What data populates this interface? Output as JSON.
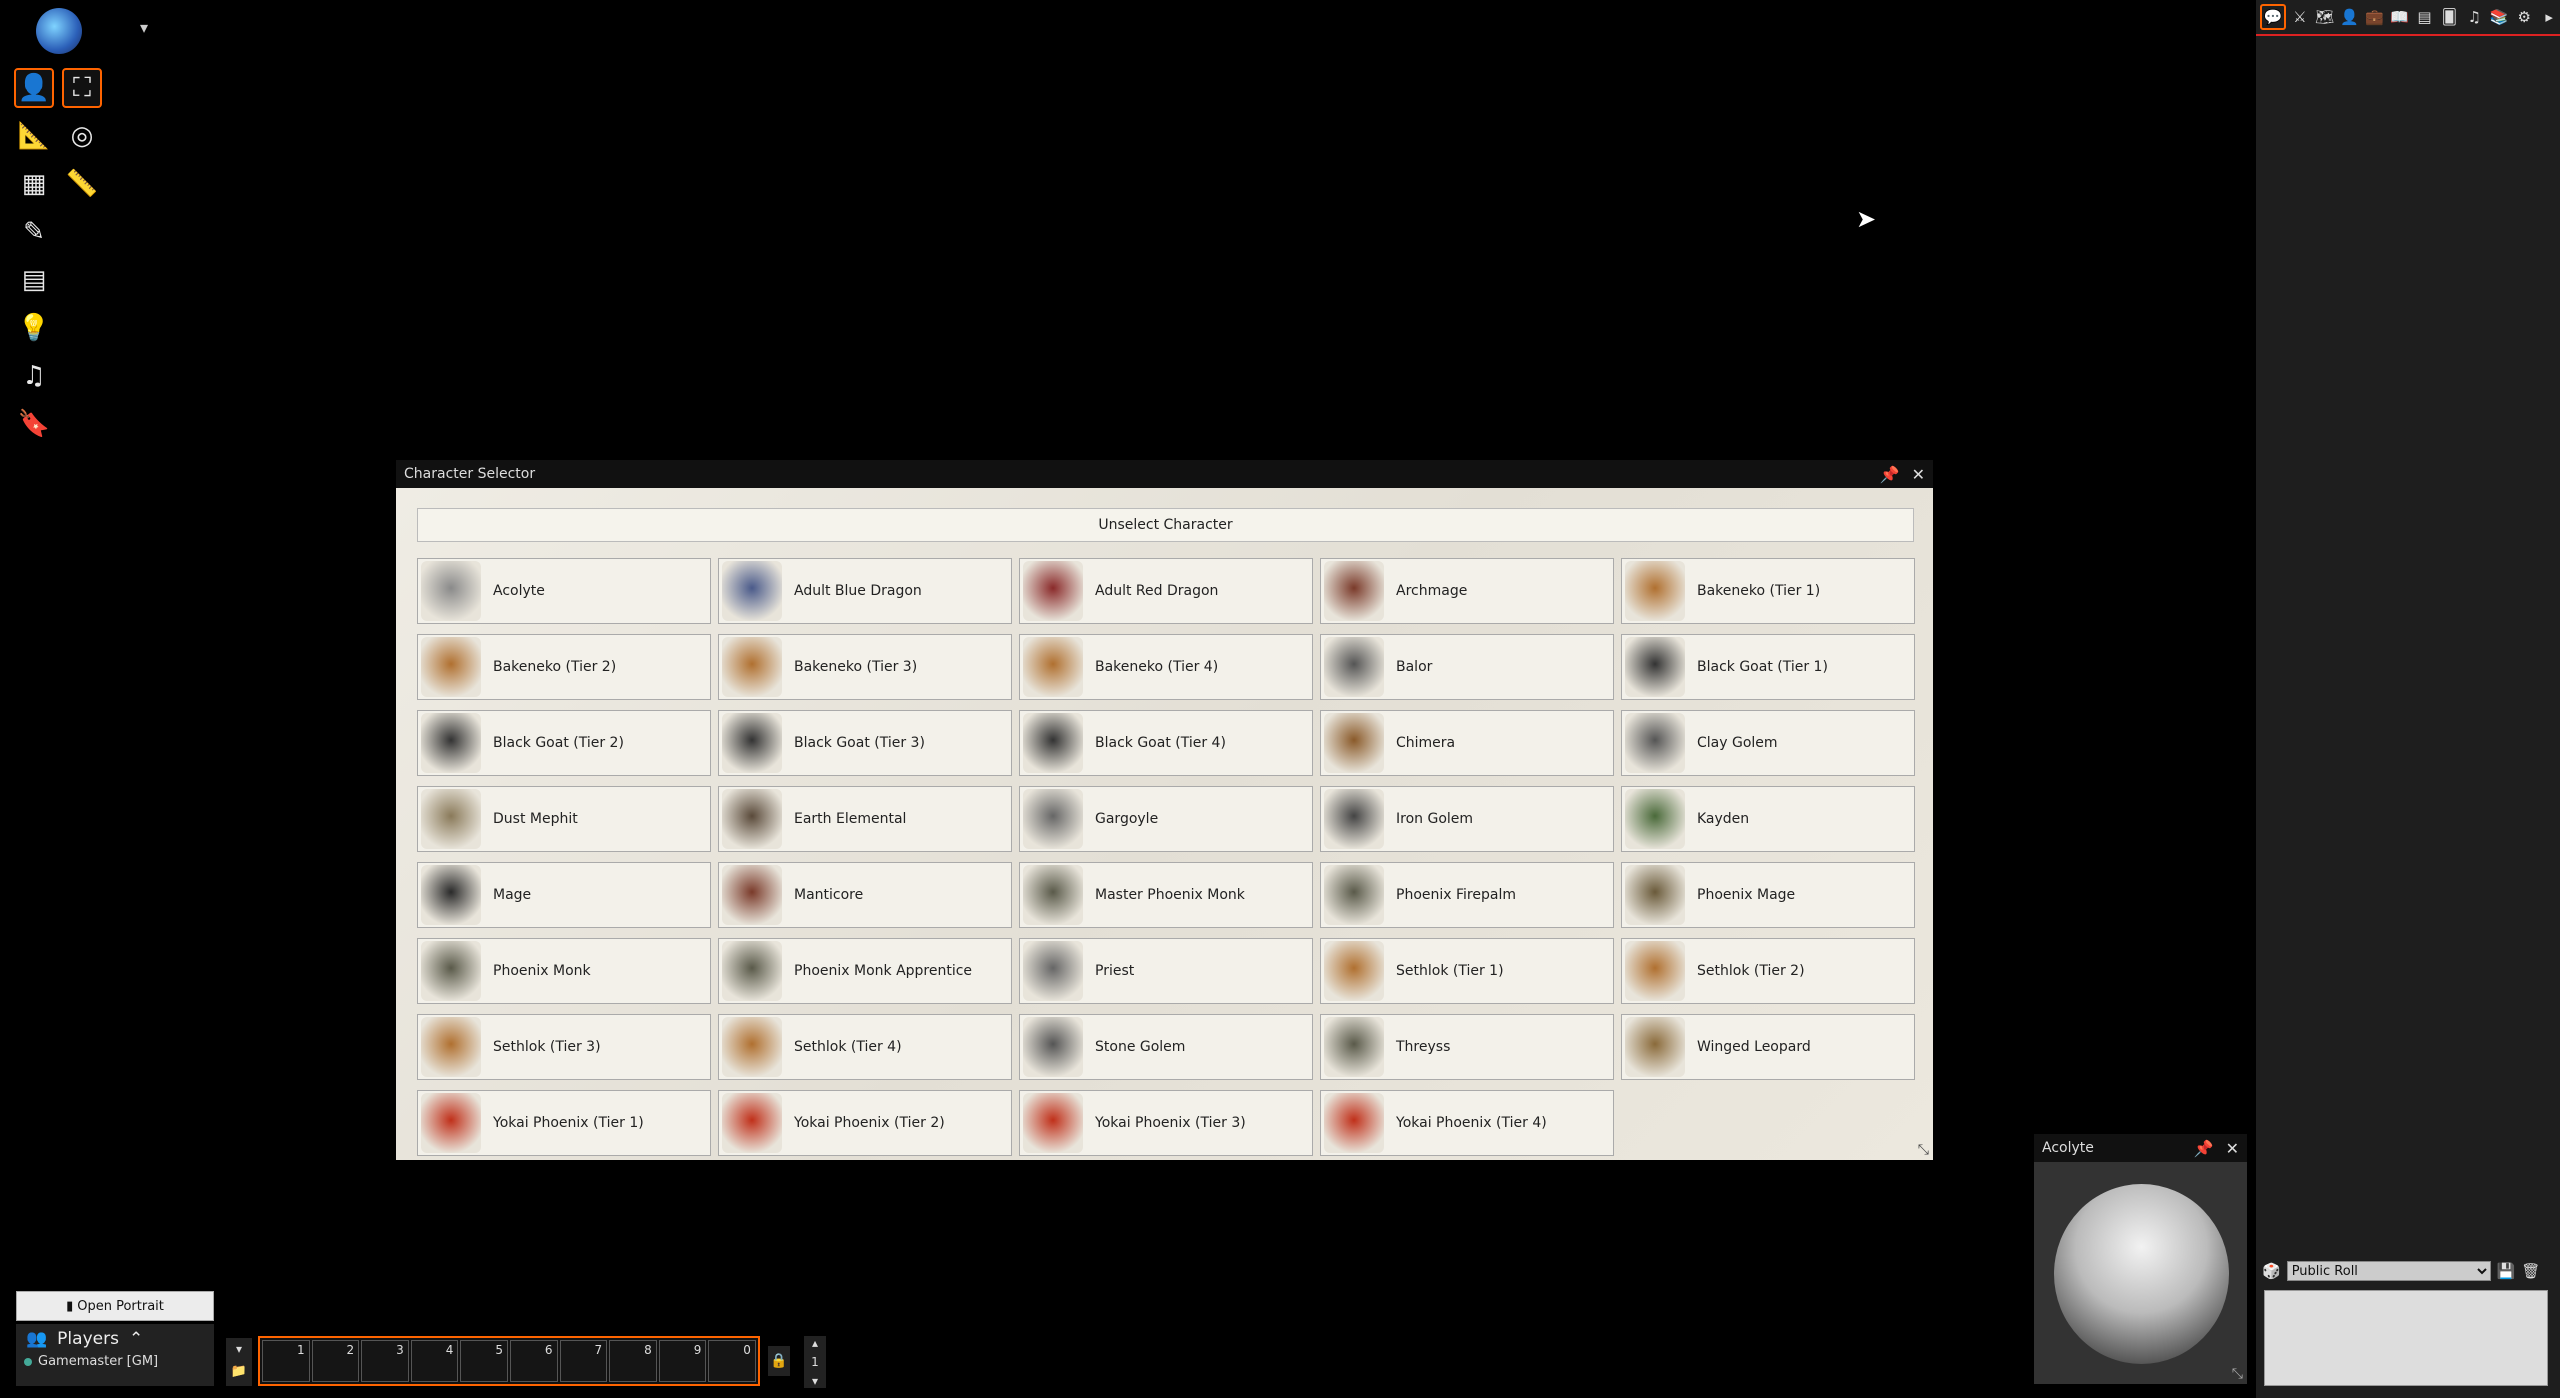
{
  "toolbar": {
    "logo_caret": "▾",
    "icons": [
      "token-controls-icon",
      "fullscreen-icon",
      "measure-icon",
      "target-icon",
      "tiles-icon",
      "ruler-icon",
      "drawing-icon",
      "walls-icon",
      "lighting-icon",
      "sounds-icon",
      "notes-icon"
    ]
  },
  "character_selector": {
    "title": "Character Selector",
    "unselect_label": "Unselect Character",
    "characters": [
      {
        "name": "Acolyte",
        "color": "#8a8a8a"
      },
      {
        "name": "Adult Blue Dragon",
        "color": "#4a5a8a"
      },
      {
        "name": "Adult Red Dragon",
        "color": "#8a2a2a"
      },
      {
        "name": "Archmage",
        "color": "#7a3a2a"
      },
      {
        "name": "Bakeneko (Tier 1)",
        "color": "#b07030"
      },
      {
        "name": "Bakeneko (Tier 2)",
        "color": "#b07030"
      },
      {
        "name": "Bakeneko (Tier 3)",
        "color": "#b07030"
      },
      {
        "name": "Bakeneko (Tier 4)",
        "color": "#b07030"
      },
      {
        "name": "Balor",
        "color": "#555555"
      },
      {
        "name": "Black Goat (Tier 1)",
        "color": "#333333"
      },
      {
        "name": "Black Goat (Tier 2)",
        "color": "#333333"
      },
      {
        "name": "Black Goat (Tier 3)",
        "color": "#333333"
      },
      {
        "name": "Black Goat (Tier 4)",
        "color": "#333333"
      },
      {
        "name": "Chimera",
        "color": "#8a5a2a"
      },
      {
        "name": "Clay Golem",
        "color": "#555555"
      },
      {
        "name": "Dust Mephit",
        "color": "#8a7a5a"
      },
      {
        "name": "Earth Elemental",
        "color": "#5a4a3a"
      },
      {
        "name": "Gargoyle",
        "color": "#666666"
      },
      {
        "name": "Iron Golem",
        "color": "#444444"
      },
      {
        "name": "Kayden",
        "color": "#4a6a3a"
      },
      {
        "name": "Mage",
        "color": "#2a2a2a"
      },
      {
        "name": "Manticore",
        "color": "#7a3a2a"
      },
      {
        "name": "Master Phoenix Monk",
        "color": "#5a5a4a"
      },
      {
        "name": "Phoenix Firepalm",
        "color": "#5a5a4a"
      },
      {
        "name": "Phoenix Mage",
        "color": "#6a5a3a"
      },
      {
        "name": "Phoenix Monk",
        "color": "#5a5a4a"
      },
      {
        "name": "Phoenix Monk Apprentice",
        "color": "#5a5a4a"
      },
      {
        "name": "Priest",
        "color": "#666666"
      },
      {
        "name": "Sethlok (Tier 1)",
        "color": "#b07030"
      },
      {
        "name": "Sethlok (Tier 2)",
        "color": "#b07030"
      },
      {
        "name": "Sethlok (Tier 3)",
        "color": "#b07030"
      },
      {
        "name": "Sethlok (Tier 4)",
        "color": "#b07030"
      },
      {
        "name": "Stone Golem",
        "color": "#555555"
      },
      {
        "name": "Threyss",
        "color": "#5a5a4a"
      },
      {
        "name": "Winged Leopard",
        "color": "#8a6a3a"
      },
      {
        "name": "Yokai Phoenix (Tier 1)",
        "color": "#c0301a"
      },
      {
        "name": "Yokai Phoenix (Tier 2)",
        "color": "#c0301a"
      },
      {
        "name": "Yokai Phoenix (Tier 3)",
        "color": "#c0301a"
      },
      {
        "name": "Yokai Phoenix (Tier 4)",
        "color": "#c0301a"
      }
    ]
  },
  "portrait_window": {
    "title": "Acolyte"
  },
  "sidebar": {
    "roll_mode": "Public Roll",
    "tab_icons": [
      "chat-icon",
      "combat-icon",
      "scenes-icon",
      "actors-icon",
      "items-icon",
      "journal-icon",
      "tables-icon",
      "cards-icon",
      "playlists-icon",
      "compendium-icon",
      "settings-icon",
      "collapse-icon"
    ]
  },
  "bottom": {
    "open_portrait_label": "Open Portrait",
    "players_label": "Players",
    "player_name": "Gamemaster [GM]",
    "hotbar_slots": [
      "1",
      "2",
      "3",
      "4",
      "5",
      "6",
      "7",
      "8",
      "9",
      "0"
    ],
    "hotbar_page": "1"
  }
}
